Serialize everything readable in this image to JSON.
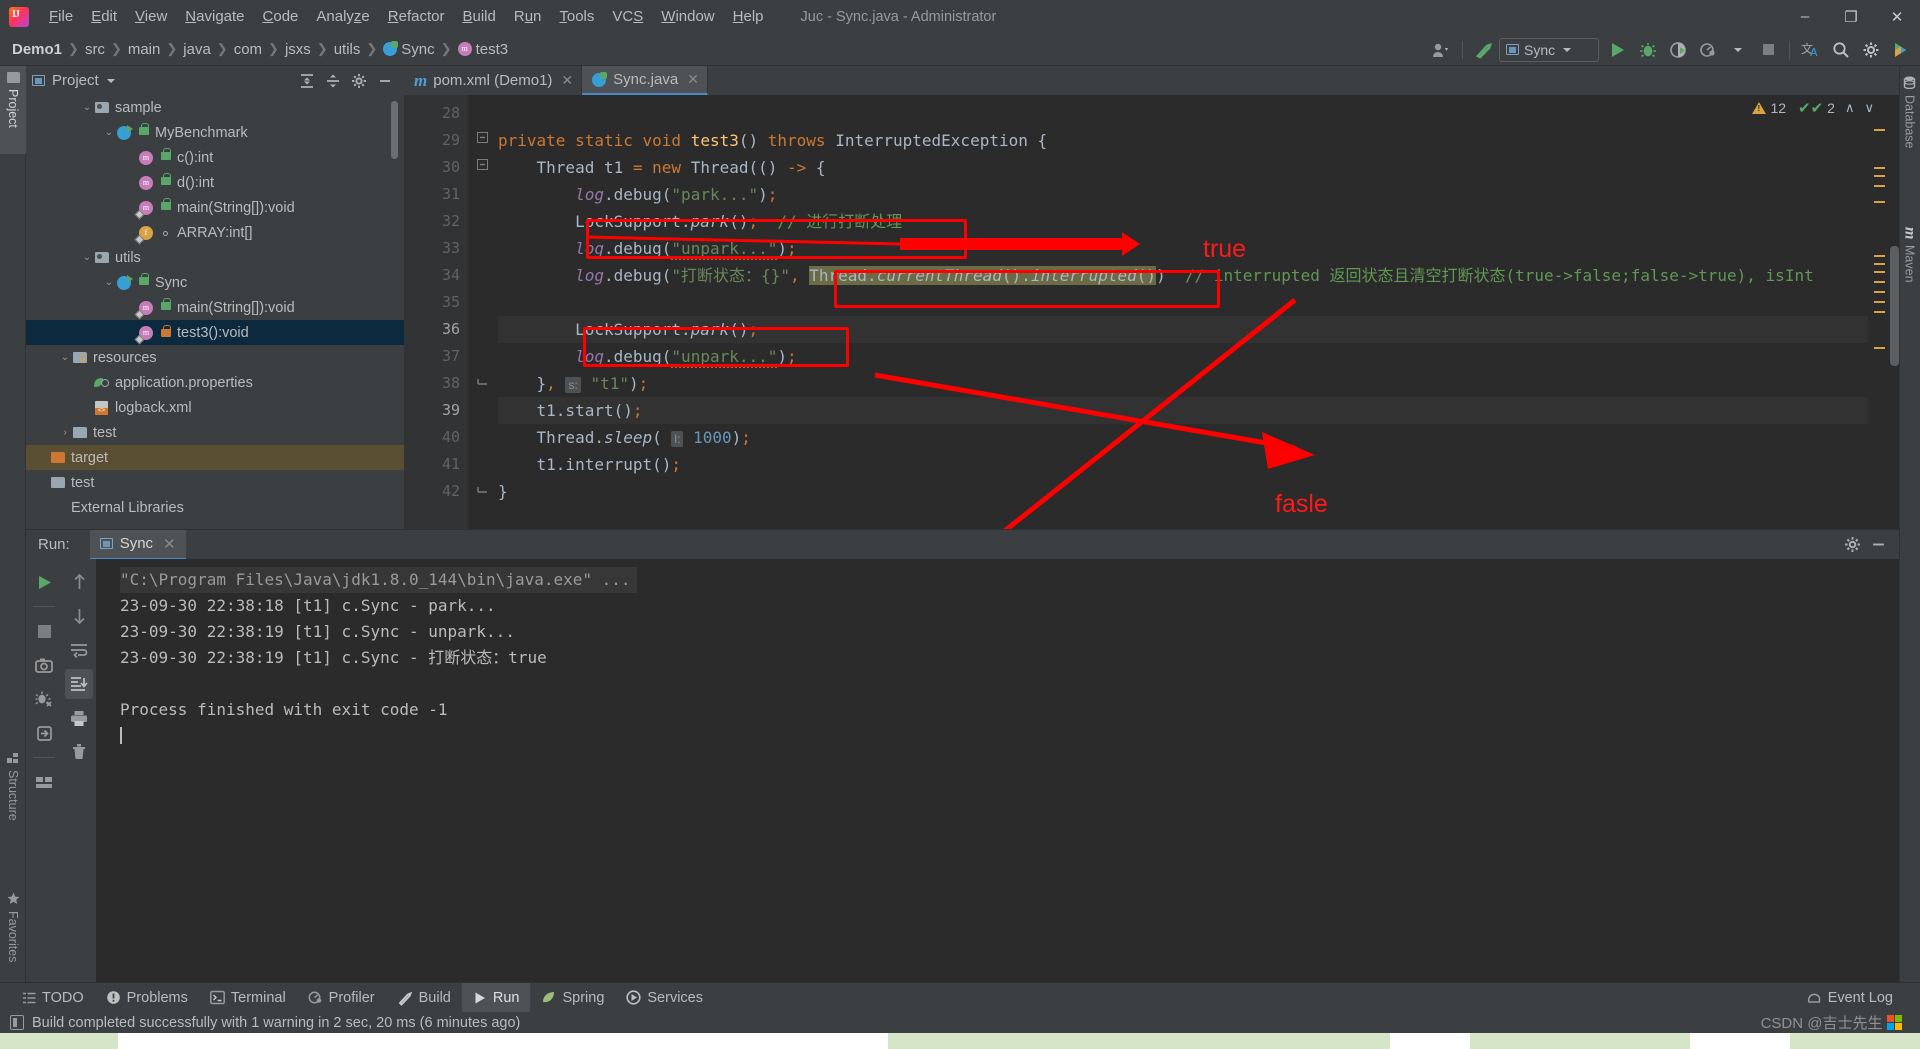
{
  "window": {
    "title": "Juc - Sync.java - Administrator",
    "minimize": "–",
    "maximize": "❐",
    "close": "✕"
  },
  "menu": [
    {
      "label": "File"
    },
    {
      "label": "Edit"
    },
    {
      "label": "View"
    },
    {
      "label": "Navigate"
    },
    {
      "label": "Code"
    },
    {
      "label": "Analyze"
    },
    {
      "label": "Refactor"
    },
    {
      "label": "Build"
    },
    {
      "label": "Run"
    },
    {
      "label": "Tools"
    },
    {
      "label": "VCS"
    },
    {
      "label": "Window"
    },
    {
      "label": "Help"
    }
  ],
  "breadcrumb": [
    {
      "label": "Demo1"
    },
    {
      "label": "src"
    },
    {
      "label": "main"
    },
    {
      "label": "java"
    },
    {
      "label": "com"
    },
    {
      "label": "jsxs"
    },
    {
      "label": "utils"
    },
    {
      "label": "Sync"
    },
    {
      "label": "test3"
    }
  ],
  "toolbar": {
    "run_config": "Sync",
    "icons": [
      "user-icon",
      "hammer-icon",
      "run-icon",
      "debug-icon",
      "coverage-icon",
      "profiler-icon",
      "stop-icon",
      "translate-icon",
      "search-icon",
      "settings-icon",
      "plugin-icon"
    ]
  },
  "left_strip": [
    {
      "label": "Project",
      "icon": "folder-icon",
      "selected": true
    },
    {
      "label": "Structure",
      "icon": "structure-icon",
      "selected": false
    },
    {
      "label": "Favorites",
      "icon": "star-icon",
      "selected": false
    }
  ],
  "right_strip": [
    {
      "label": "Database",
      "icon": "database-icon"
    },
    {
      "label": "Maven",
      "icon": "maven-icon"
    }
  ],
  "project_panel": {
    "title": "Project",
    "header_icons": [
      "expand-all-icon",
      "collapse-all-icon",
      "gear-icon",
      "hide-icon"
    ],
    "tree": [
      {
        "label": "sample",
        "depth": 2,
        "icon": "package-folder",
        "arrow": "down",
        "visibility": null,
        "selected": false
      },
      {
        "label": "MyBenchmark",
        "depth": 3,
        "icon": "class",
        "arrow": "down",
        "visibility": "public-green",
        "selected": false
      },
      {
        "label": "c():int",
        "depth": 4,
        "icon": "method",
        "arrow": "none",
        "visibility": "public-green",
        "selected": false
      },
      {
        "label": "d():int",
        "depth": 4,
        "icon": "method",
        "arrow": "none",
        "visibility": "public-green",
        "selected": false
      },
      {
        "label": "main(String[]):void",
        "depth": 4,
        "icon": "method-static",
        "arrow": "none",
        "visibility": "public-green",
        "selected": false
      },
      {
        "label": "ARRAY:int[]",
        "depth": 4,
        "icon": "field-static",
        "arrow": "none",
        "visibility": "package-dot",
        "selected": false
      },
      {
        "label": "utils",
        "depth": 2,
        "icon": "package-folder",
        "arrow": "down",
        "visibility": null,
        "selected": false
      },
      {
        "label": "Sync",
        "depth": 3,
        "icon": "class",
        "arrow": "down",
        "visibility": "public-green",
        "selected": false
      },
      {
        "label": "main(String[]):void",
        "depth": 4,
        "icon": "method-static",
        "arrow": "none",
        "visibility": "public-green",
        "selected": false
      },
      {
        "label": "test3():void",
        "depth": 4,
        "icon": "method-static",
        "arrow": "none",
        "visibility": "private-orange",
        "selected": true
      },
      {
        "label": "resources",
        "depth": 1,
        "icon": "resources-folder",
        "arrow": "down",
        "visibility": null,
        "selected": false
      },
      {
        "label": "application.properties",
        "depth": 2,
        "icon": "properties-file",
        "arrow": "none",
        "visibility": null,
        "selected": false
      },
      {
        "label": "logback.xml",
        "depth": 2,
        "icon": "xml-file",
        "arrow": "none",
        "visibility": null,
        "selected": false
      },
      {
        "label": "test",
        "depth": 1,
        "icon": "plain-folder",
        "arrow": "right",
        "visibility": null,
        "selected": false
      },
      {
        "label": "target",
        "depth": 0,
        "icon": "target-folder",
        "arrow": "none",
        "visibility": null,
        "selected": false,
        "highlight": "excluded"
      },
      {
        "label": "test",
        "depth": 0,
        "icon": "plain-folder",
        "arrow": "none",
        "visibility": null,
        "selected": false
      },
      {
        "label": "External Libraries",
        "depth": 0,
        "icon": "none",
        "arrow": "none",
        "visibility": null,
        "selected": false
      }
    ]
  },
  "editor": {
    "tabs": [
      {
        "label": "pom.xml (Demo1)",
        "icon": "maven-icon",
        "active": false,
        "close": "✕"
      },
      {
        "label": "Sync.java",
        "icon": "class-icon",
        "active": true,
        "close": "✕"
      }
    ],
    "inspections": {
      "warning_count": "12",
      "check_count": "2",
      "up_arrow": "∧",
      "down_arrow": "∨"
    },
    "first_line": 28,
    "lines": [
      {
        "n": 28,
        "text": ""
      },
      {
        "n": 29,
        "text": "    private static void test3() throws InterruptedException {",
        "fold": "minus"
      },
      {
        "n": 30,
        "text": "        Thread t1 = new Thread(() -> {",
        "fold": "minus"
      },
      {
        "n": 31,
        "text": "            log.debug(\"park...\");"
      },
      {
        "n": 32,
        "text": "            LockSupport.park();  // 进行打断处理"
      },
      {
        "n": 33,
        "text": "            log.debug(\"unpark...\");"
      },
      {
        "n": 34,
        "text": "            log.debug(\"打断状态：{}\", Thread.currentThread().interrupted())  // interrupted 返回状态且清空打断状态(true->false;false->true), isInt"
      },
      {
        "n": 35,
        "text": ""
      },
      {
        "n": 36,
        "text": "            LockSupport.park();",
        "current": true
      },
      {
        "n": 37,
        "text": "            log.debug(\"unpark...\");"
      },
      {
        "n": 38,
        "text": "        }, s: \"t1\");",
        "fold": "end"
      },
      {
        "n": 39,
        "text": "        t1.start();",
        "highlighted": true
      },
      {
        "n": 40,
        "text": "        Thread.sleep( l: 1000);"
      },
      {
        "n": 41,
        "text": "        t1.interrupt();"
      },
      {
        "n": 42,
        "text": "    }",
        "fold": "end"
      }
    ],
    "trailing_comment": "// interrupted 返回状态且清空打断状态(true->false;false->true), isInt"
  },
  "annotations": [
    {
      "name": "true-top",
      "text": "true",
      "color": "#ff1a1a"
    },
    {
      "name": "fasle-mid",
      "text": "fasle",
      "color": "#ff1a1a"
    },
    {
      "name": "true-bottom",
      "text": "true",
      "color": "#ff1a1a"
    }
  ],
  "run_panel": {
    "label": "Run:",
    "tab": "Sync",
    "tab_close": "✕",
    "toolbar_left": [
      "rerun-icon",
      "stop-icon",
      "screenshot-icon",
      "dump-threads-icon",
      "restore-layout-icon",
      "layout-icon"
    ],
    "toolbar_right": [
      "up-icon",
      "down-icon",
      "soft-wrap-icon",
      "scroll-to-end-icon",
      "print-icon",
      "trash-icon"
    ],
    "header_icons": [
      "gear-icon",
      "hide-icon"
    ],
    "console": [
      {
        "text": "\"C:\\Program Files\\Java\\jdk1.8.0_144\\bin\\java.exe\" ...",
        "kind": "system"
      },
      {
        "text": "23-09-30 22:38:18 [t1] c.Sync - park...",
        "kind": "out"
      },
      {
        "text": "23-09-30 22:38:19 [t1] c.Sync - unpark...",
        "kind": "out"
      },
      {
        "text": "23-09-30 22:38:19 [t1] c.Sync - 打断状态：true",
        "kind": "out"
      },
      {
        "text": "",
        "kind": "out"
      },
      {
        "text": "Process finished with exit code -1",
        "kind": "out"
      }
    ]
  },
  "bottom_bar": {
    "items": [
      {
        "label": "TODO",
        "icon": "todo-icon",
        "selected": false
      },
      {
        "label": "Problems",
        "icon": "problems-icon",
        "selected": false
      },
      {
        "label": "Terminal",
        "icon": "terminal-icon",
        "selected": false
      },
      {
        "label": "Profiler",
        "icon": "profiler-icon",
        "selected": false
      },
      {
        "label": "Build",
        "icon": "build-icon",
        "selected": false
      },
      {
        "label": "Run",
        "icon": "run-icon",
        "selected": true
      },
      {
        "label": "Spring",
        "icon": "spring-icon",
        "selected": false
      },
      {
        "label": "Services",
        "icon": "services-icon",
        "selected": false
      }
    ],
    "event_log": "Event Log"
  },
  "status_bar": {
    "message": "Build completed successfully with 1 warning in 2 sec, 20 ms (6 minutes ago)"
  },
  "watermark": "CSDN @吉士先生",
  "colors": {
    "accent": "#4a88c7",
    "annotation_red": "#ff1a1a",
    "editor_bg": "#2b2b2b",
    "panel_bg": "#3c3f41",
    "selection": "#0d293e",
    "keyword": "#cc7832",
    "string": "#6a8759",
    "comment": "#629755",
    "number": "#6897bb",
    "method": "#ffc66d",
    "field": "#9876aa"
  }
}
